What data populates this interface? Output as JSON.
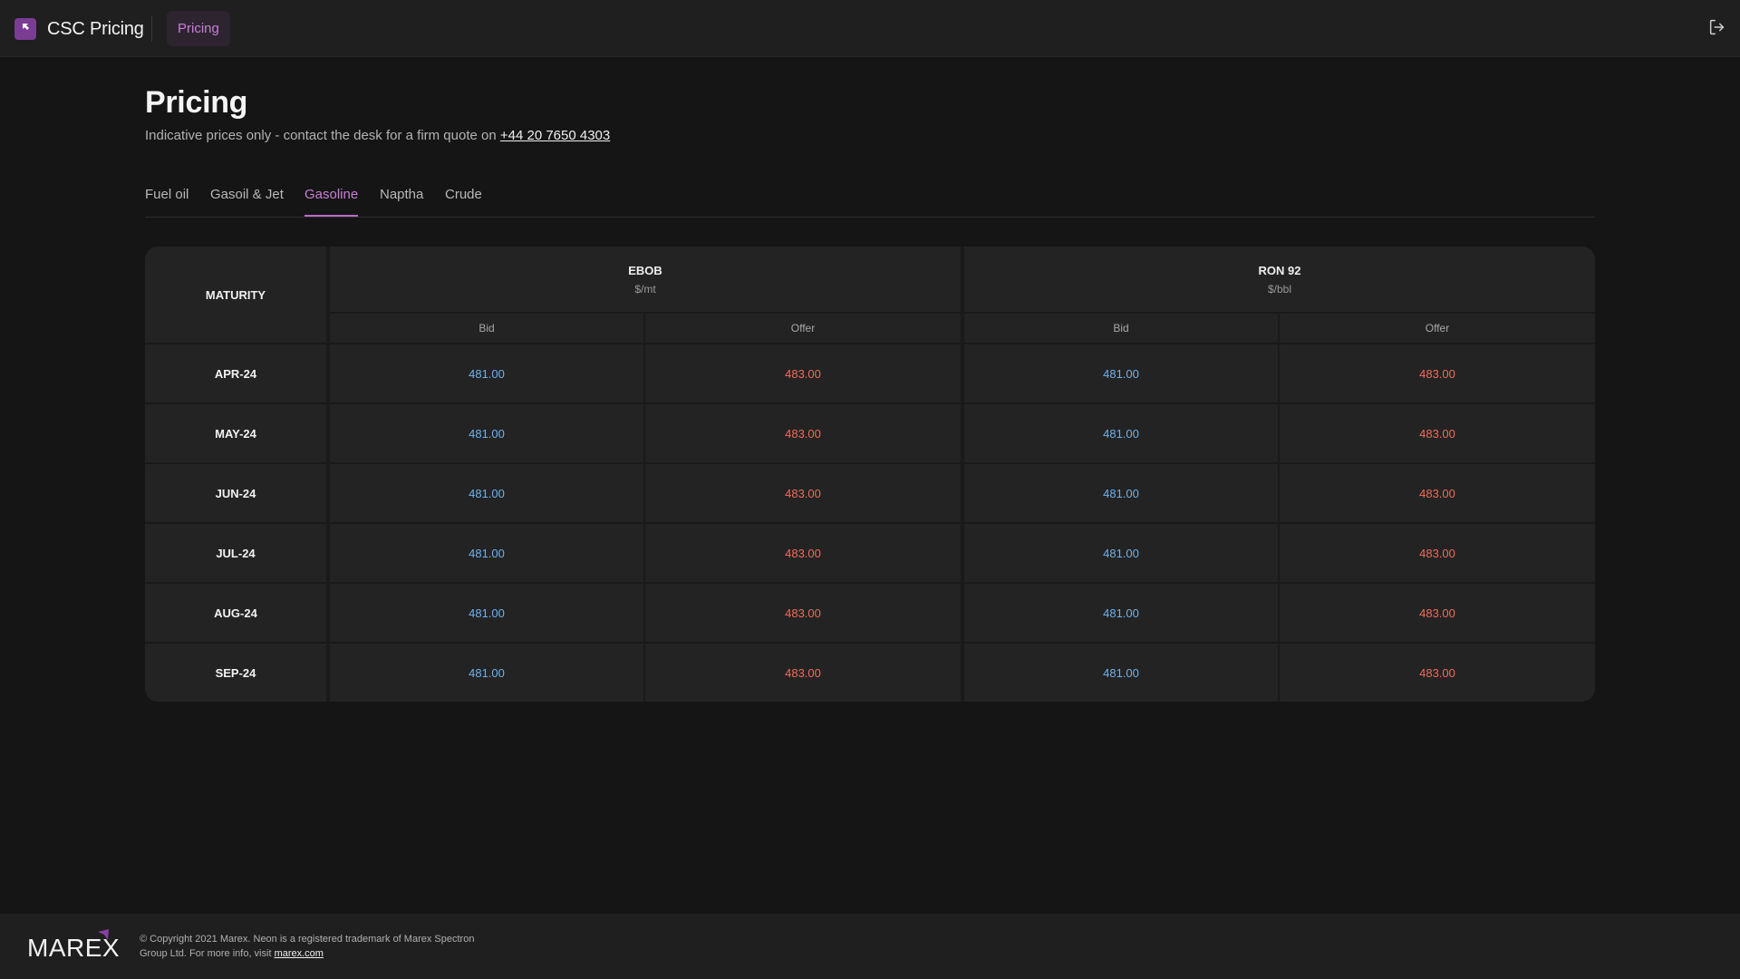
{
  "header": {
    "app_title": "CSC Pricing",
    "nav_item": "Pricing",
    "logo_icon": "arrow-up-left-icon",
    "logout_icon": "logout-icon"
  },
  "page": {
    "title": "Pricing",
    "subtitle_prefix": "Indicative prices only - contact the desk for a firm quote on ",
    "phone": "+44 20 7650 4303"
  },
  "tabs": [
    {
      "label": "Fuel oil",
      "active": false
    },
    {
      "label": "Gasoil & Jet",
      "active": false
    },
    {
      "label": "Gasoline",
      "active": true
    },
    {
      "label": "Naptha",
      "active": false
    },
    {
      "label": "Crude",
      "active": false
    }
  ],
  "table": {
    "maturity_header": "MATURITY",
    "groups": [
      {
        "name": "EBOB",
        "unit": "$/mt"
      },
      {
        "name": "RON 92",
        "unit": "$/bbl"
      }
    ],
    "sub_headers": [
      "Bid",
      "Offer",
      "Bid",
      "Offer"
    ],
    "rows": [
      {
        "maturity": "APR-24",
        "values": [
          "481.00",
          "483.00",
          "481.00",
          "483.00"
        ]
      },
      {
        "maturity": "MAY-24",
        "values": [
          "481.00",
          "483.00",
          "481.00",
          "483.00"
        ]
      },
      {
        "maturity": "JUN-24",
        "values": [
          "481.00",
          "483.00",
          "481.00",
          "483.00"
        ]
      },
      {
        "maturity": "JUL-24",
        "values": [
          "481.00",
          "483.00",
          "481.00",
          "483.00"
        ]
      },
      {
        "maturity": "AUG-24",
        "values": [
          "481.00",
          "483.00",
          "481.00",
          "483.00"
        ]
      },
      {
        "maturity": "SEP-24",
        "values": [
          "481.00",
          "483.00",
          "481.00",
          "483.00"
        ]
      }
    ]
  },
  "footer": {
    "logo_text": "MAREX",
    "copyright_line": "© Copyright 2021 Marex. Neon is a registered trademark of Marex Spectron Group Ltd. For more info, visit ",
    "link_text": "marex.com"
  },
  "colors": {
    "accent": "#c77ed6",
    "bid": "#6fb2ec",
    "offer": "#ef6b5d",
    "background": "#151515"
  }
}
